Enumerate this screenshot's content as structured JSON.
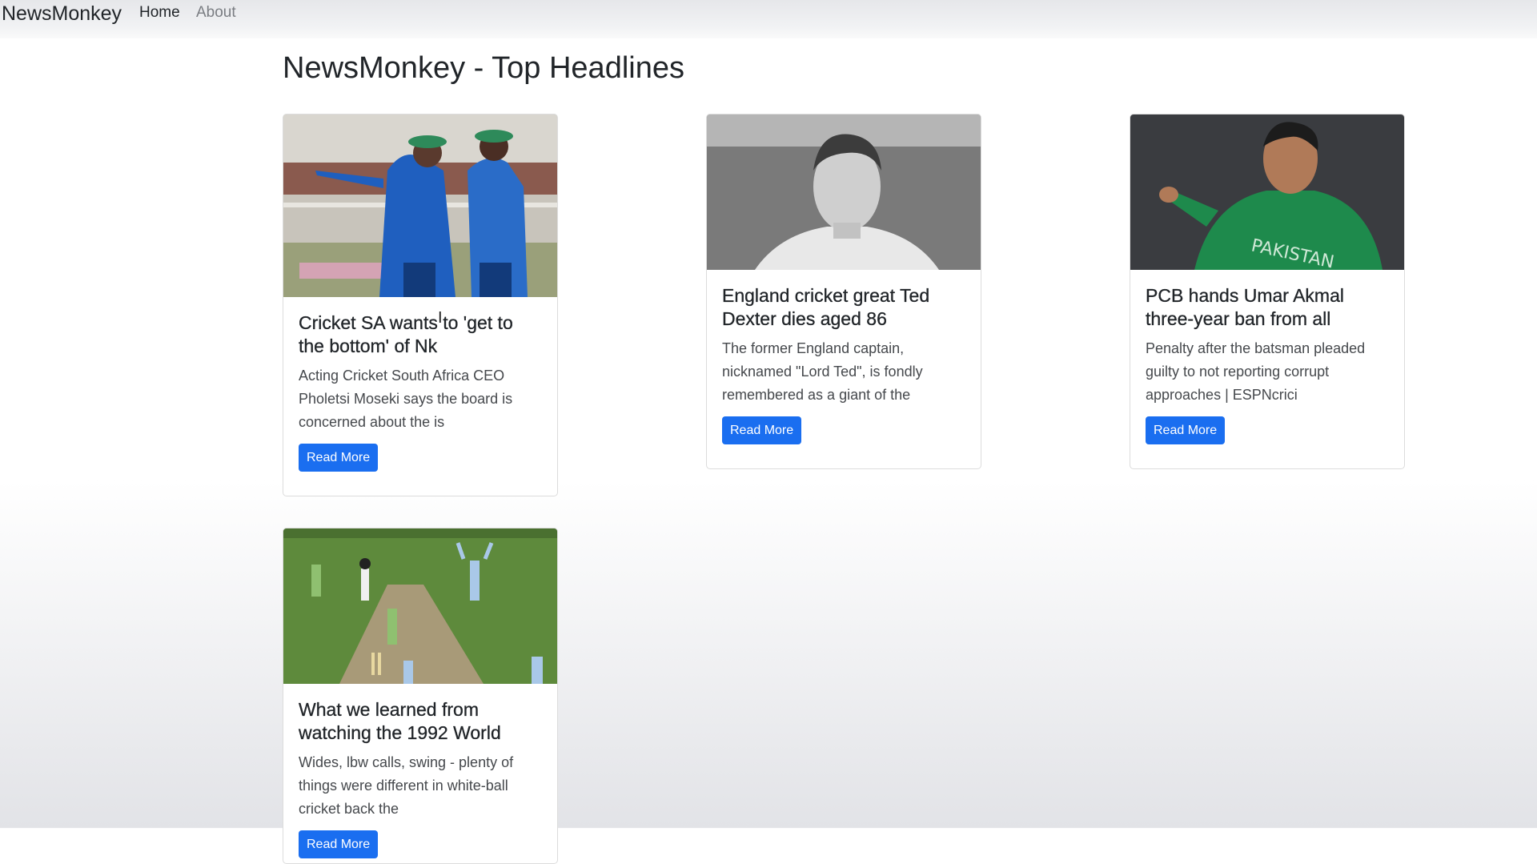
{
  "navbar": {
    "brand": "NewsMonkey",
    "links": [
      {
        "label": "Home"
      },
      {
        "label": "About"
      }
    ]
  },
  "page": {
    "title": "NewsMonkey - Top Headlines"
  },
  "articles": [
    {
      "title": "Cricket SA wants to 'get to the bottom' of Nk",
      "description": "Acting Cricket South Africa CEO Pholetsi Moseki says the board is concerned about the is",
      "button": "Read More",
      "image": "cricket-coaches-photo"
    },
    {
      "title": "England cricket great Ted Dexter dies aged 86",
      "description": "The former England captain, nicknamed \"Lord Ted\", is fondly remembered as a giant of the",
      "button": "Read More",
      "image": "black-and-white-portrait-photo"
    },
    {
      "title": "PCB hands Umar Akmal three-year ban from all",
      "description": "Penalty after the batsman pleaded guilty to not reporting corrupt approaches | ESPNcrici",
      "button": "Read More",
      "image": "pakistan-player-photo"
    },
    {
      "title": "What we learned from watching the 1992 World",
      "description": "Wides, lbw calls, swing - plenty of things were different in white-ball cricket back the",
      "button": "Read More",
      "image": "cricket-match-photo"
    }
  ],
  "colors": {
    "primary_button": "#1a6ef0",
    "nav_inactive": "#7a7d82"
  }
}
